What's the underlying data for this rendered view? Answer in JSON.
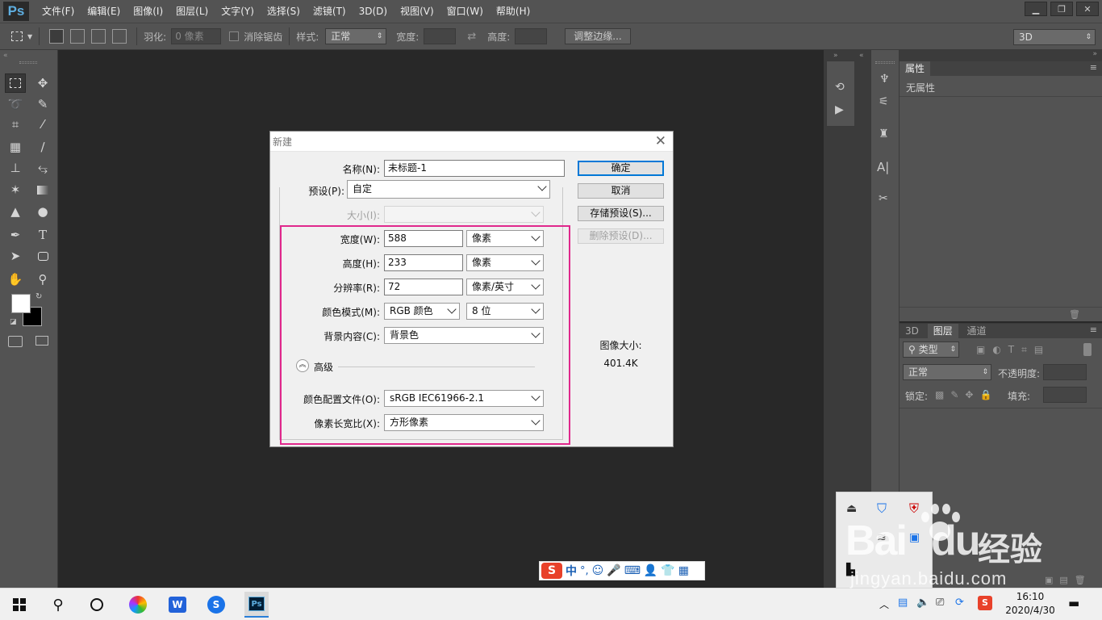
{
  "menubar": {
    "logo": "Ps",
    "items": [
      "文件(F)",
      "编辑(E)",
      "图像(I)",
      "图层(L)",
      "文字(Y)",
      "选择(S)",
      "滤镜(T)",
      "3D(D)",
      "视图(V)",
      "窗口(W)",
      "帮助(H)"
    ]
  },
  "options": {
    "feather_label": "羽化:",
    "feather_value": "0 像素",
    "antialias_label": "消除锯齿",
    "style_label": "样式:",
    "style_value": "正常",
    "width_label": "宽度:",
    "height_label": "高度:",
    "refine_edge": "调整边缘...",
    "workspace": "3D"
  },
  "properties_panel": {
    "tab": "属性",
    "empty_text": "无属性"
  },
  "layers_panel": {
    "tabs": [
      "3D",
      "图层",
      "通道"
    ],
    "filter_label": "类型",
    "blend_mode": "正常",
    "opacity_label": "不透明度:",
    "lock_label": "锁定:",
    "fill_label": "填充:"
  },
  "dialog": {
    "title": "新建",
    "name_label": "名称(N):",
    "name_value": "未标题-1",
    "preset_label": "预设(P):",
    "preset_value": "自定",
    "size_label": "大小(I):",
    "width_label": "宽度(W):",
    "width_value": "588",
    "width_unit": "像素",
    "height_label": "高度(H):",
    "height_value": "233",
    "height_unit": "像素",
    "resolution_label": "分辨率(R):",
    "resolution_value": "72",
    "resolution_unit": "像素/英寸",
    "colormode_label": "颜色模式(M):",
    "colormode_value": "RGB 颜色",
    "bitdepth_value": "8 位",
    "background_label": "背景内容(C):",
    "background_value": "背景色",
    "advanced_label": "高级",
    "profile_label": "颜色配置文件(O):",
    "profile_value": "sRGB IEC61966-2.1",
    "aspect_label": "像素长宽比(X):",
    "aspect_value": "方形像素",
    "ok_button": "确定",
    "cancel_button": "取消",
    "save_preset_button": "存储预设(S)...",
    "delete_preset_button": "删除预设(D)...",
    "image_size_label": "图像大小:",
    "image_size_value": "401.4K"
  },
  "ime": {
    "mode": "中"
  },
  "watermark": {
    "brand": "Bai",
    "brand2": "du",
    "suffix": "经验",
    "url": "jingyan.baidu.com"
  },
  "taskbar": {
    "time": "16:10",
    "date": "2020/4/30"
  },
  "colors": {
    "highlight_box": "#e0288c",
    "ps_blue": "#5eaee0",
    "default_button_border": "#0078d7"
  }
}
